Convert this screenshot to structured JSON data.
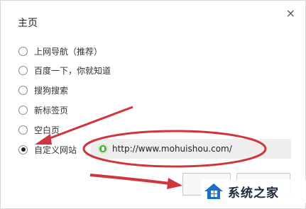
{
  "dialog": {
    "title": "主页",
    "close_label": "×"
  },
  "options": [
    {
      "label": "上网导航（推荐）",
      "checked": false
    },
    {
      "label": "百度一下，你就知道",
      "checked": false
    },
    {
      "label": "搜狗搜索",
      "checked": false
    },
    {
      "label": "新标签页",
      "checked": false
    },
    {
      "label": "空白页",
      "checked": false
    },
    {
      "label": "自定义网站",
      "checked": true
    }
  ],
  "custom_url": {
    "value": "http://www.mohuishou.com/",
    "icon": "green-leaf-icon"
  },
  "buttons": {
    "confirm_label": "",
    "cancel_label": ""
  },
  "watermark": {
    "text": "系统之家"
  },
  "colors": {
    "annotation_red": "#d0343c",
    "field_bg": "#eeeeee",
    "watermark_blue": "#1f6fc4"
  }
}
